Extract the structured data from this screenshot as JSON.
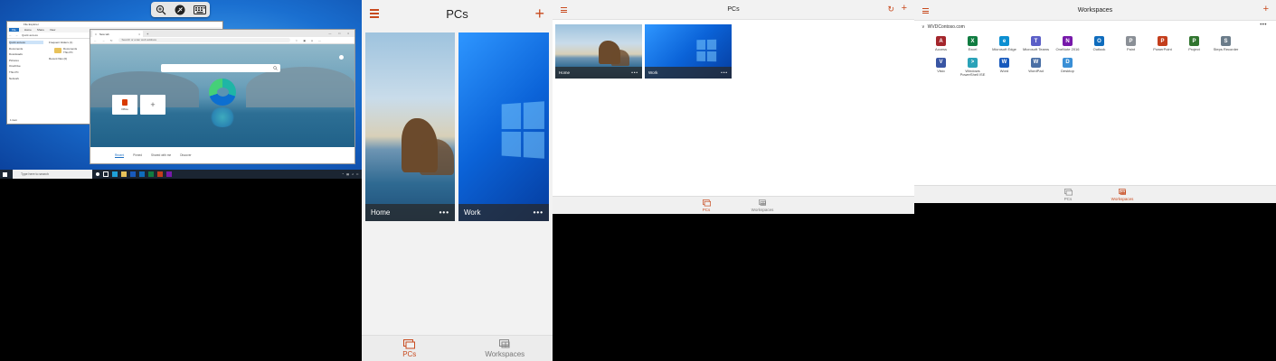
{
  "desktop": {
    "toolbar": {
      "icons": [
        "zoom-in-icon",
        "disconnect-icon",
        "keyboard-icon"
      ]
    },
    "explorer": {
      "title": "File Explorer",
      "ribbon": [
        "File",
        "Home",
        "Share",
        "View"
      ],
      "address": "Quick access",
      "nav": [
        "Quick access",
        "Documents",
        "Downloads",
        "Pictures",
        "OneDrive",
        "This PC",
        "Network"
      ],
      "frequent_header": "Frequent folders (1)",
      "folder_name": "Documents",
      "folder_sub": "This PC",
      "recent_header": "Recent files (0)",
      "status": "1 item"
    },
    "edge": {
      "tab_title": "New tab",
      "address_placeholder": "Search or enter web address",
      "quick_links": [
        "Office"
      ],
      "bottom_tabs": [
        "Recent",
        "Pinned",
        "Shared with me",
        "Discover"
      ]
    },
    "taskbar": {
      "search_placeholder": "Type here to search"
    }
  },
  "pcs_mobile": {
    "title": "PCs",
    "tiles": [
      {
        "label": "Home"
      },
      {
        "label": "Work"
      }
    ],
    "nav": [
      {
        "label": "PCs"
      },
      {
        "label": "Workspaces"
      }
    ]
  },
  "pcs_tablet": {
    "title": "PCs",
    "tiles": [
      {
        "label": "Home"
      },
      {
        "label": "Work"
      }
    ],
    "nav": [
      {
        "label": "PCs"
      },
      {
        "label": "Workspaces"
      }
    ]
  },
  "workspaces": {
    "title": "Workspaces",
    "feed": "WVDContoso.com",
    "apps": [
      {
        "label": "Access",
        "letter": "A",
        "color": "#a4262c"
      },
      {
        "label": "Excel",
        "letter": "X",
        "color": "#107c41"
      },
      {
        "label": "Microsoft Edge",
        "letter": "e",
        "color": "#0c8fd1"
      },
      {
        "label": "Microsoft Teams",
        "letter": "T",
        "color": "#5b5fc7"
      },
      {
        "label": "OneNote 2016",
        "letter": "N",
        "color": "#7719aa"
      },
      {
        "label": "Outlook",
        "letter": "O",
        "color": "#0f6cbd"
      },
      {
        "label": "Paint",
        "letter": "P",
        "color": "#8a8f96"
      },
      {
        "label": "PowerPoint",
        "letter": "P",
        "color": "#c43e1c"
      },
      {
        "label": "Project",
        "letter": "P",
        "color": "#31752f"
      },
      {
        "label": "Steps Recorder",
        "letter": "S",
        "color": "#6b7c8a"
      },
      {
        "label": "",
        "letter": "",
        "color": "#ffffff"
      },
      {
        "label": "Visio",
        "letter": "V",
        "color": "#3955a3"
      },
      {
        "label": "Windows PowerShell ISE",
        "letter": ">",
        "color": "#2aa2b8"
      },
      {
        "label": "Word",
        "letter": "W",
        "color": "#185abd"
      },
      {
        "label": "WordPad",
        "letter": "W",
        "color": "#4a6fa5"
      },
      {
        "label": "Desktop",
        "letter": "D",
        "color": "#3a8fd6"
      }
    ],
    "nav": [
      {
        "label": "PCs"
      },
      {
        "label": "Workspaces"
      }
    ]
  },
  "colors": {
    "accent": "#c84a1e",
    "nav_inactive": "#777777"
  }
}
